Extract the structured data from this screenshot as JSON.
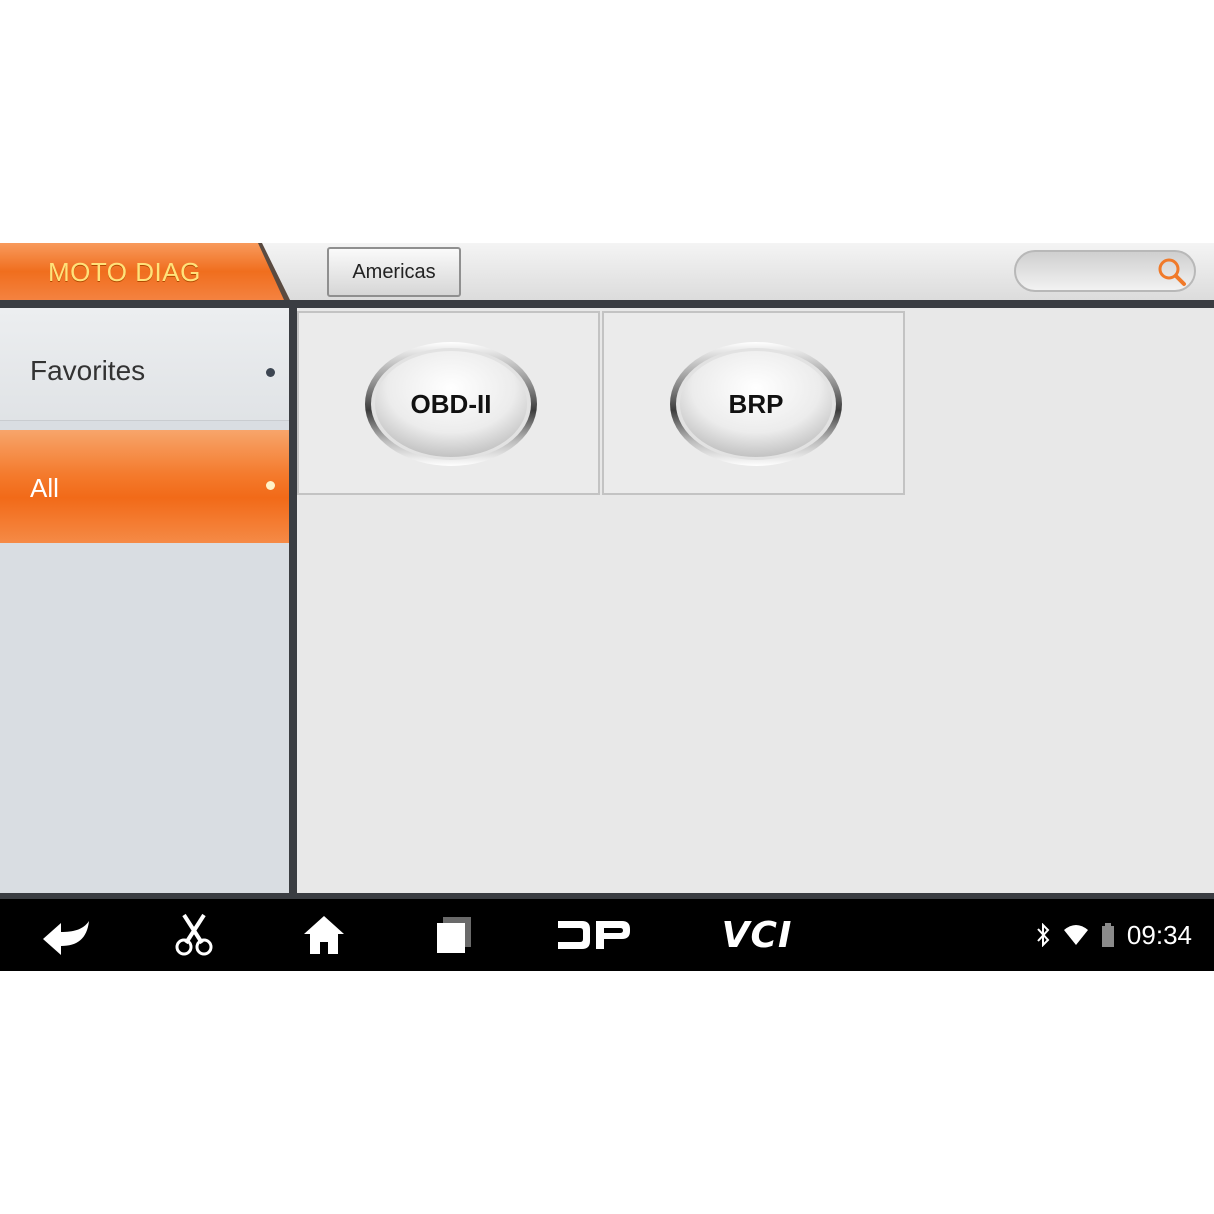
{
  "header": {
    "app_title": "MOTO DIAG",
    "region_button": "Americas",
    "search_placeholder": ""
  },
  "sidebar": {
    "items": [
      {
        "label": "Favorites",
        "selected": false
      },
      {
        "label": "All",
        "selected": true
      }
    ]
  },
  "content": {
    "tiles": [
      {
        "label": "OBD-II",
        "icon": "oval-button"
      },
      {
        "label": "BRP",
        "icon": "oval-button"
      }
    ]
  },
  "navbar": {
    "buttons": [
      "back-icon",
      "screenshot-scissors-icon",
      "home-icon",
      "recent-apps-icon",
      "dp-logo-icon"
    ],
    "vci_label": "VCI"
  },
  "status": {
    "time": "09:34",
    "icons": [
      "bluetooth-icon",
      "wifi-icon",
      "battery-icon"
    ]
  },
  "colors": {
    "accent": "#f26a18",
    "app_title_text": "#ffe27a",
    "sidebar_bg": "#d9dde2",
    "navbar_bg": "#000000"
  }
}
